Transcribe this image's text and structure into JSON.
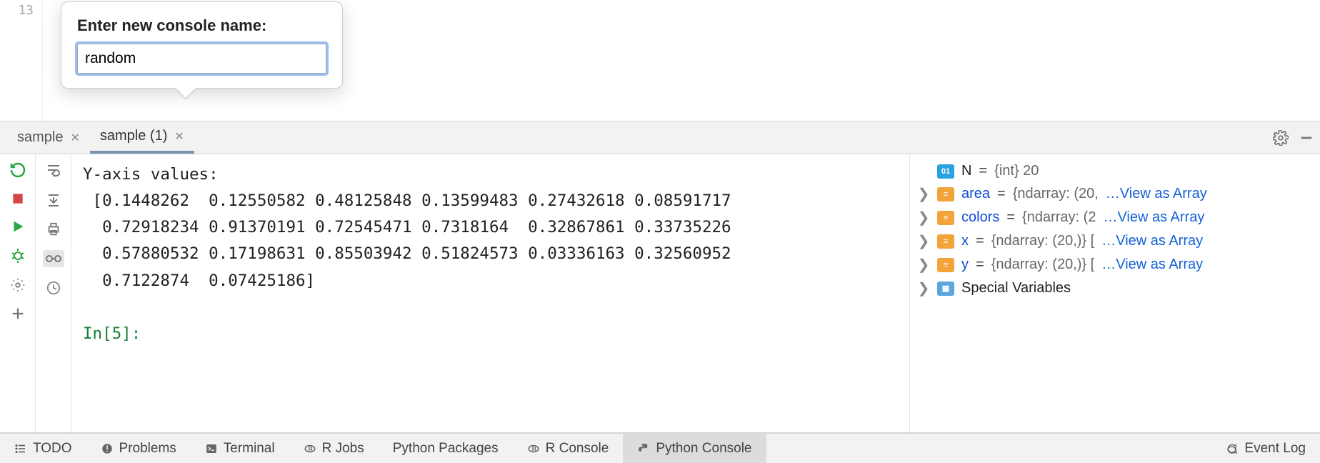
{
  "editor": {
    "line_number": "13"
  },
  "popover": {
    "label": "Enter new console name:",
    "value": "random"
  },
  "tabs": {
    "items": [
      {
        "label": "sample"
      },
      {
        "label": "sample (1)"
      }
    ]
  },
  "console": {
    "heading": "Y-axis values:",
    "line1": " [0.1448262  0.12550582 0.48125848 0.13599483 0.27432618 0.08591717",
    "line2": "  0.72918234 0.91370191 0.72545471 0.7318164  0.32867861 0.33735226",
    "line3": "  0.57880532 0.17198631 0.85503942 0.51824573 0.03336163 0.32560952",
    "line4": "  0.7122874  0.07425186]",
    "prompt": "In[5]: "
  },
  "variables": {
    "n": {
      "name": "N",
      "eq": "=",
      "val": "{int} 20"
    },
    "area": {
      "name": "area",
      "eq": "=",
      "val": "{ndarray: (20,",
      "link": "…View as Array"
    },
    "colors": {
      "name": "colors",
      "eq": "=",
      "val": "{ndarray: (2",
      "link": "…View as Array"
    },
    "x": {
      "name": "x",
      "eq": "=",
      "val": "{ndarray: (20,)} [",
      "link": "…View as Array"
    },
    "y": {
      "name": "y",
      "eq": "=",
      "val": "{ndarray: (20,)} [",
      "link": "…View as Array"
    },
    "special": {
      "name": "Special Variables"
    }
  },
  "bottom": {
    "todo": "TODO",
    "problems": "Problems",
    "terminal": "Terminal",
    "rjobs": "R Jobs",
    "pypkg": "Python Packages",
    "rconsole": "R Console",
    "pyconsole": "Python Console",
    "eventlog": "Event Log"
  }
}
